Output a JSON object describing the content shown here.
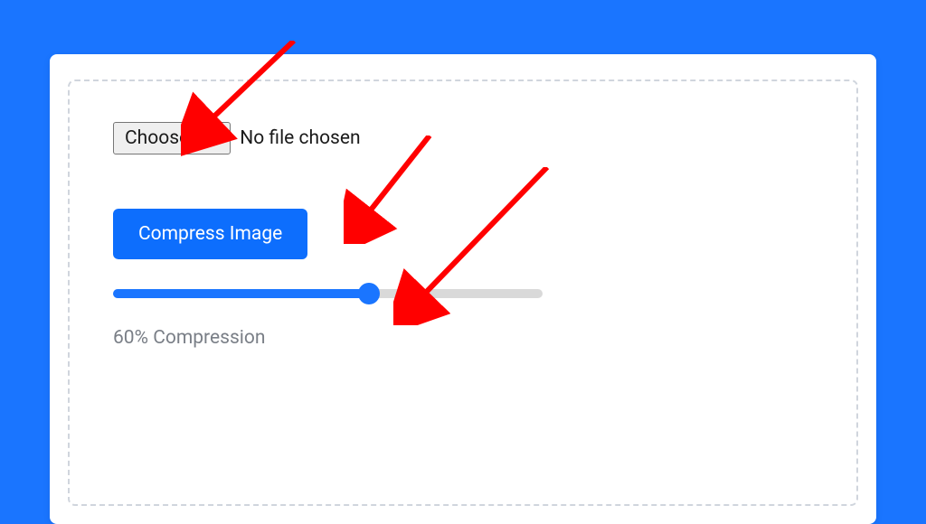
{
  "filePicker": {
    "buttonLabel": "Choose file",
    "statusText": "No file chosen"
  },
  "actions": {
    "compressLabel": "Compress Image"
  },
  "slider": {
    "value": 60,
    "min": 0,
    "max": 100
  },
  "compressionText": "60% Compression",
  "colors": {
    "pageBackground": "#1a75ff",
    "primaryButton": "#0d6efd",
    "arrowColor": "#ff0000"
  }
}
